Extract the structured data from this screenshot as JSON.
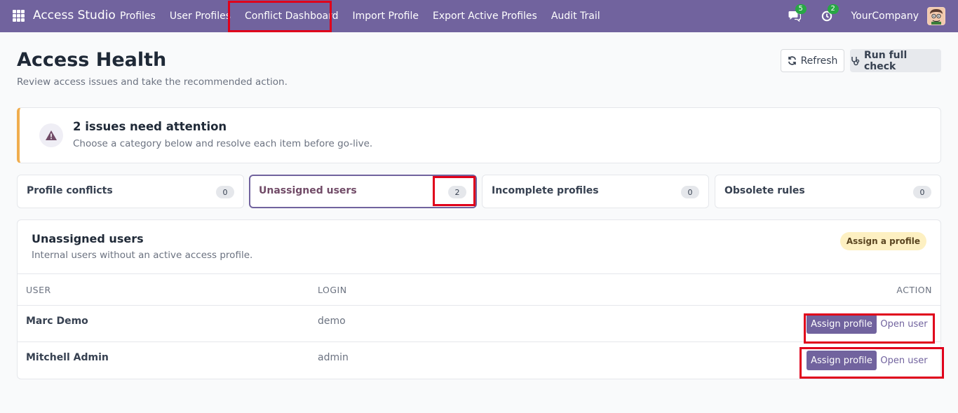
{
  "navbar": {
    "brand": "Access Studio",
    "menu": [
      "Profiles",
      "User Profiles",
      "Conflict Dashboard",
      "Import Profile",
      "Export Active Profiles",
      "Audit Trail"
    ],
    "messages_count": "5",
    "activities_count": "2",
    "company": "YourCompany"
  },
  "header": {
    "title": "Access Health",
    "subtitle": "Review access issues and take the recommended action.",
    "refresh_label": "Refresh",
    "run_label": "Run full check"
  },
  "alert": {
    "title": "2 issues need attention",
    "text": "Choose a category below and resolve each item before go-live."
  },
  "categories": [
    {
      "label": "Profile conflicts",
      "count": "0"
    },
    {
      "label": "Unassigned users",
      "count": "2"
    },
    {
      "label": "Incomplete profiles",
      "count": "0"
    },
    {
      "label": "Obsolete rules",
      "count": "0"
    }
  ],
  "section": {
    "title": "Unassigned users",
    "subtitle": "Internal users without an active access profile.",
    "badge": "Assign a profile",
    "columns": {
      "user": "USER",
      "login": "LOGIN",
      "action": "ACTION"
    },
    "rows": [
      {
        "user": "Marc Demo",
        "login": "demo",
        "assign_label": "Assign profile",
        "open_label": "Open user"
      },
      {
        "user": "Mitchell Admin",
        "login": "admin",
        "assign_label": "Assign profile",
        "open_label": "Open user"
      }
    ]
  },
  "colors": {
    "navbar": "#71639e",
    "accent": "#71639e",
    "highlight": "#e0001b",
    "alert_border": "#f0ad4e"
  }
}
